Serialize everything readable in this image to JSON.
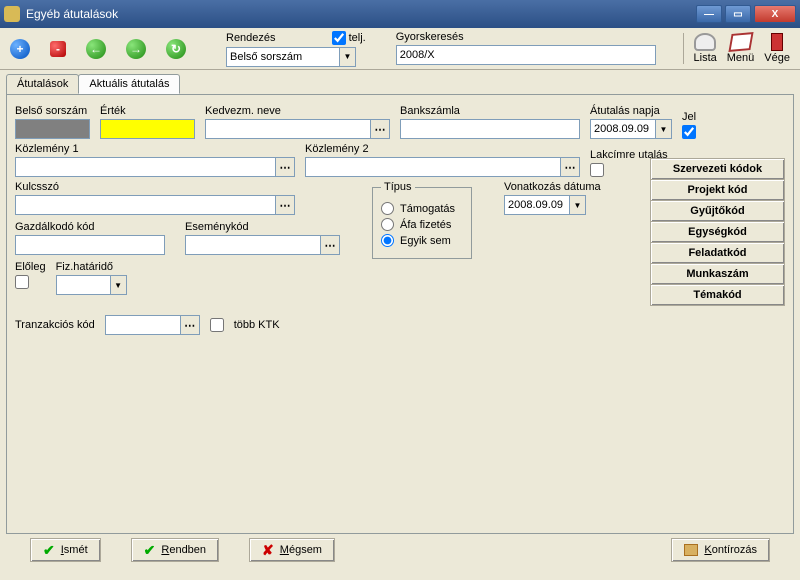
{
  "title": "Egyéb átutalások",
  "winbtns": {
    "min": "—",
    "max": "▭",
    "close": "X"
  },
  "toolbar": {
    "add": "+",
    "del": "-",
    "back": "←",
    "fwd": "→",
    "refresh": "↻",
    "rendezes": "Rendezés",
    "telj": "telj.",
    "rendezes_combo": "Belső sorszám",
    "gyors": "Gyorskeresés",
    "gyors_val": "2008/X"
  },
  "right_tb": {
    "lista": "Lista",
    "menu": "Menü",
    "vege": "Vége"
  },
  "tabs": {
    "t1": "Átutalások",
    "t2": "Aktuális átutalás"
  },
  "fields": {
    "belso": "Belső sorszám",
    "ertek": "Érték",
    "kedv": "Kedvezm. neve",
    "bank": "Bankszámla",
    "napja": "Átutalás napja",
    "napja_val": "2008.09.09",
    "jel": "Jel",
    "kozl1": "Közlemény 1",
    "kozl2": "Közlemény 2",
    "lakcimre": "Lakcímre utalás",
    "kulcs": "Kulcsszó",
    "gazd": "Gazdálkodó kód",
    "esem": "Eseménykód",
    "eloleg": "Előleg",
    "fizhat": "Fiz.határidő",
    "tranz": "Tranzakciós kód",
    "tobbktk": "több KTK"
  },
  "tipus": {
    "legend": "Típus",
    "t1": "Támogatás",
    "t2": "Áfa fizetés",
    "t3": "Egyik sem"
  },
  "vonat": {
    "label": "Vonatkozás dátuma",
    "val": "2008.09.09"
  },
  "sidebtns": {
    "b1": "Szervezeti kódok",
    "b2": "Projekt kód",
    "b3": "Gyűjtőkód",
    "b4": "Egységkód",
    "b5": "Feladatkód",
    "b6": "Munkaszám",
    "b7": "Témakód"
  },
  "bottom": {
    "ismet": "Ismét",
    "rendben": "Rendben",
    "megsem": "Mégsem",
    "kontir": "Kontírozás"
  },
  "lookup_btn": "⋯",
  "combo_btn": "▼"
}
